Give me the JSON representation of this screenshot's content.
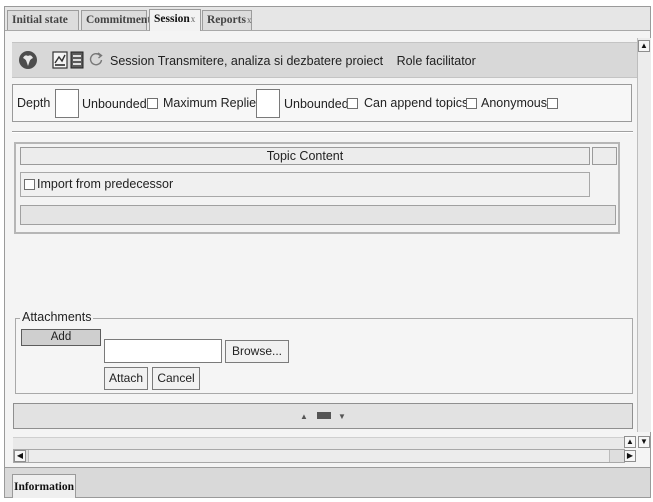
{
  "tabs": [
    {
      "label": "Initial state",
      "closable": false,
      "active": false
    },
    {
      "label": "Commitment",
      "closable": false,
      "active": false
    },
    {
      "label": "Session",
      "closable": true,
      "active": true,
      "close_glyph": "x"
    },
    {
      "label": "Reports",
      "closable": true,
      "active": false,
      "close_glyph": "x"
    }
  ],
  "toolbar": {
    "icons": [
      "brain-icon",
      "report-icon",
      "document-icon",
      "refresh-icon"
    ],
    "session_label": "Session",
    "session_name": "Transmitere, analiza si dezbatere proiect",
    "role_label": "Role",
    "role_value": "facilitator"
  },
  "params": {
    "depth_label": "Depth",
    "depth_value": "",
    "depth_unbounded_label": "Unbounded",
    "depth_unbounded_checked": false,
    "max_replies_label": "Maximum Replies",
    "max_replies_value": "",
    "max_replies_unbounded_label": "Unbounded",
    "max_replies_unbounded_checked": false,
    "can_append_label": "Can append topics",
    "can_append_checked": false,
    "anonymous_label": "Anonymous",
    "anonymous_checked": false
  },
  "topic_table": {
    "header": "Topic Content",
    "import_label": "Import from predecessor",
    "import_checked": false
  },
  "attachments": {
    "legend": "Attachments",
    "add_label": "Add",
    "file_value": "",
    "browse_label": "Browse...",
    "attach_label": "Attach",
    "cancel_label": "Cancel"
  },
  "splitter": {
    "up_glyph": "▲",
    "down_glyph": "▼"
  },
  "bottom_tabs": [
    {
      "label": "Information",
      "active": true
    }
  ],
  "colors": {
    "frame_bg": "#f4f4f4",
    "toolbar_bg": "#d8d8d8",
    "border": "#9a9a9a"
  }
}
